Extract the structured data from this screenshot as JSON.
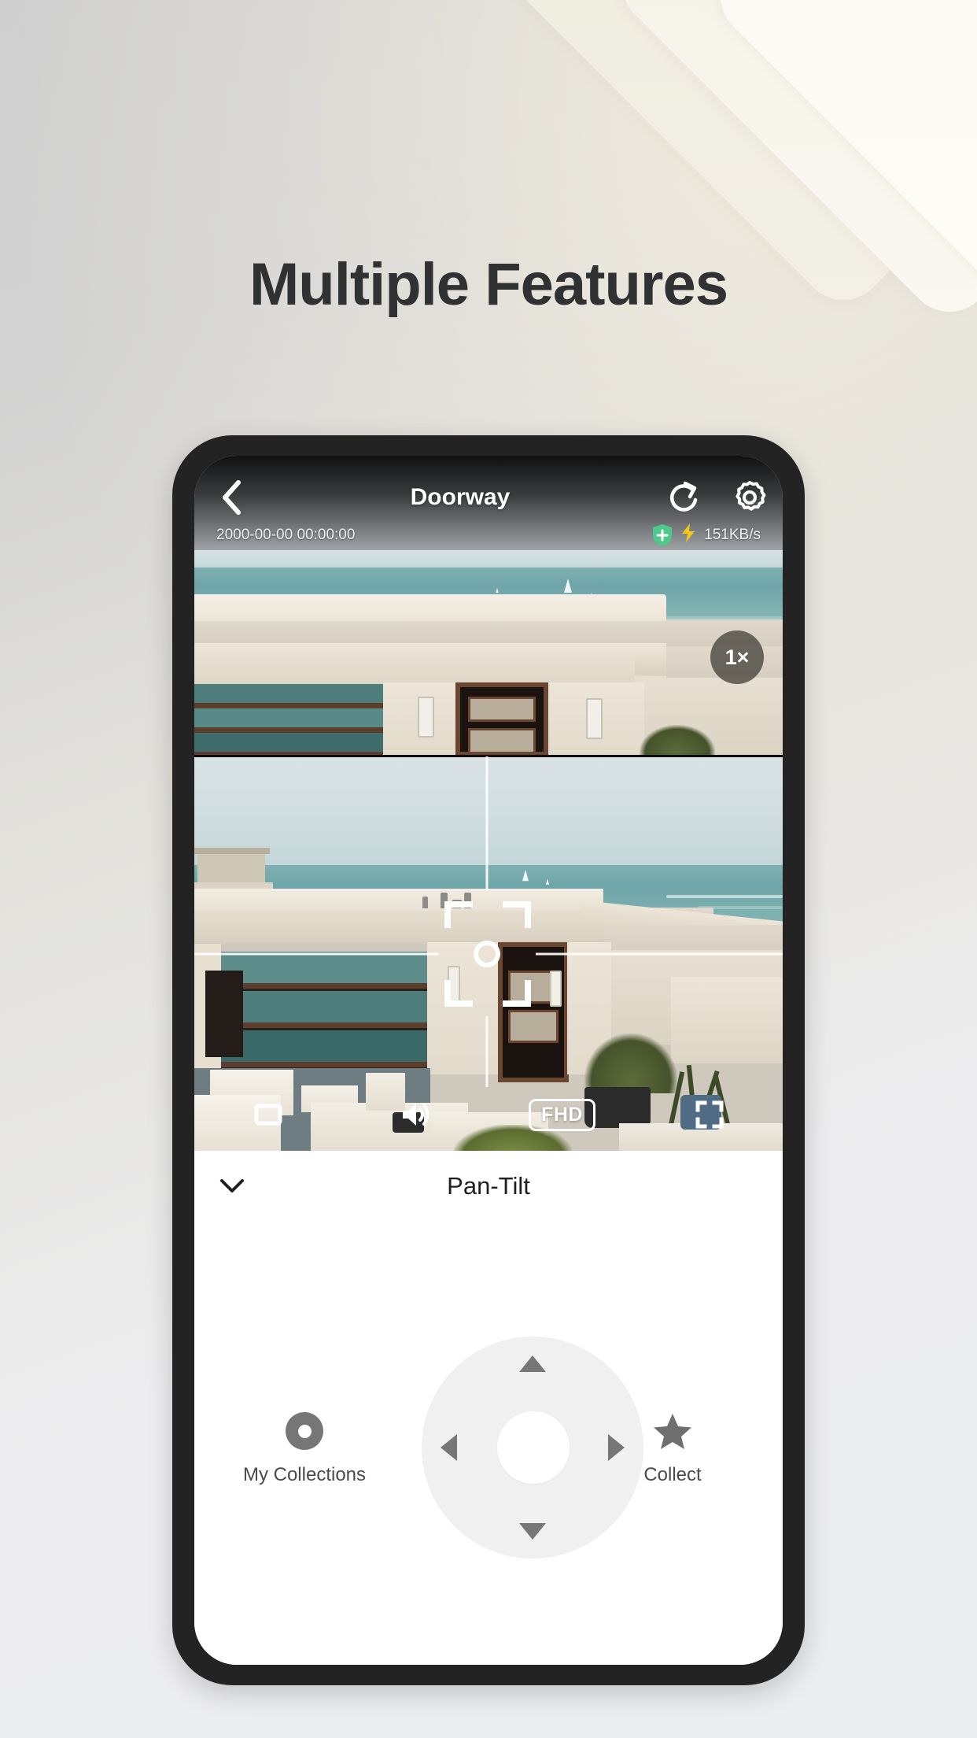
{
  "page": {
    "headline": "Multiple Features",
    "background_top_color": "#cfcfcf",
    "background_bottom_color": "#ecedef",
    "accent_cream": "#f3f0e6"
  },
  "app": {
    "header": {
      "back_icon": "chevron-left-icon",
      "title": "Doorway",
      "share_icon": "share-icon",
      "settings_icon": "gear-icon"
    },
    "status": {
      "timestamp": "2000-00-00 00:00:00",
      "shield_icon": "shield-plus-icon",
      "shield_color": "#4ec98a",
      "bolt_icon": "lightning-bolt-icon",
      "bolt_color": "#f5c518",
      "network_speed": "151KB/s"
    },
    "video": {
      "zoom_badge": "1×",
      "reticle_icon": "focus-reticle-icon",
      "controls": [
        {
          "name": "snapshot",
          "icon": "rectangle-icon",
          "label": ""
        },
        {
          "name": "audio",
          "icon": "speaker-on-icon",
          "label": ""
        },
        {
          "name": "quality",
          "icon": "quality-badge",
          "label": "FHD"
        },
        {
          "name": "fullscreen",
          "icon": "fullscreen-icon",
          "label": ""
        }
      ]
    },
    "pan_tilt": {
      "collapse_icon": "chevron-down-icon",
      "title": "Pan-Tilt",
      "dpad": {
        "up_icon": "triangle-up-icon",
        "down_icon": "triangle-down-icon",
        "left_icon": "triangle-left-icon",
        "right_icon": "triangle-right-icon",
        "center_icon": "dpad-center-icon"
      },
      "left_button": {
        "icon": "ring-target-icon",
        "label": "My Collections"
      },
      "right_button": {
        "icon": "star-icon",
        "label": "Collect"
      }
    }
  }
}
